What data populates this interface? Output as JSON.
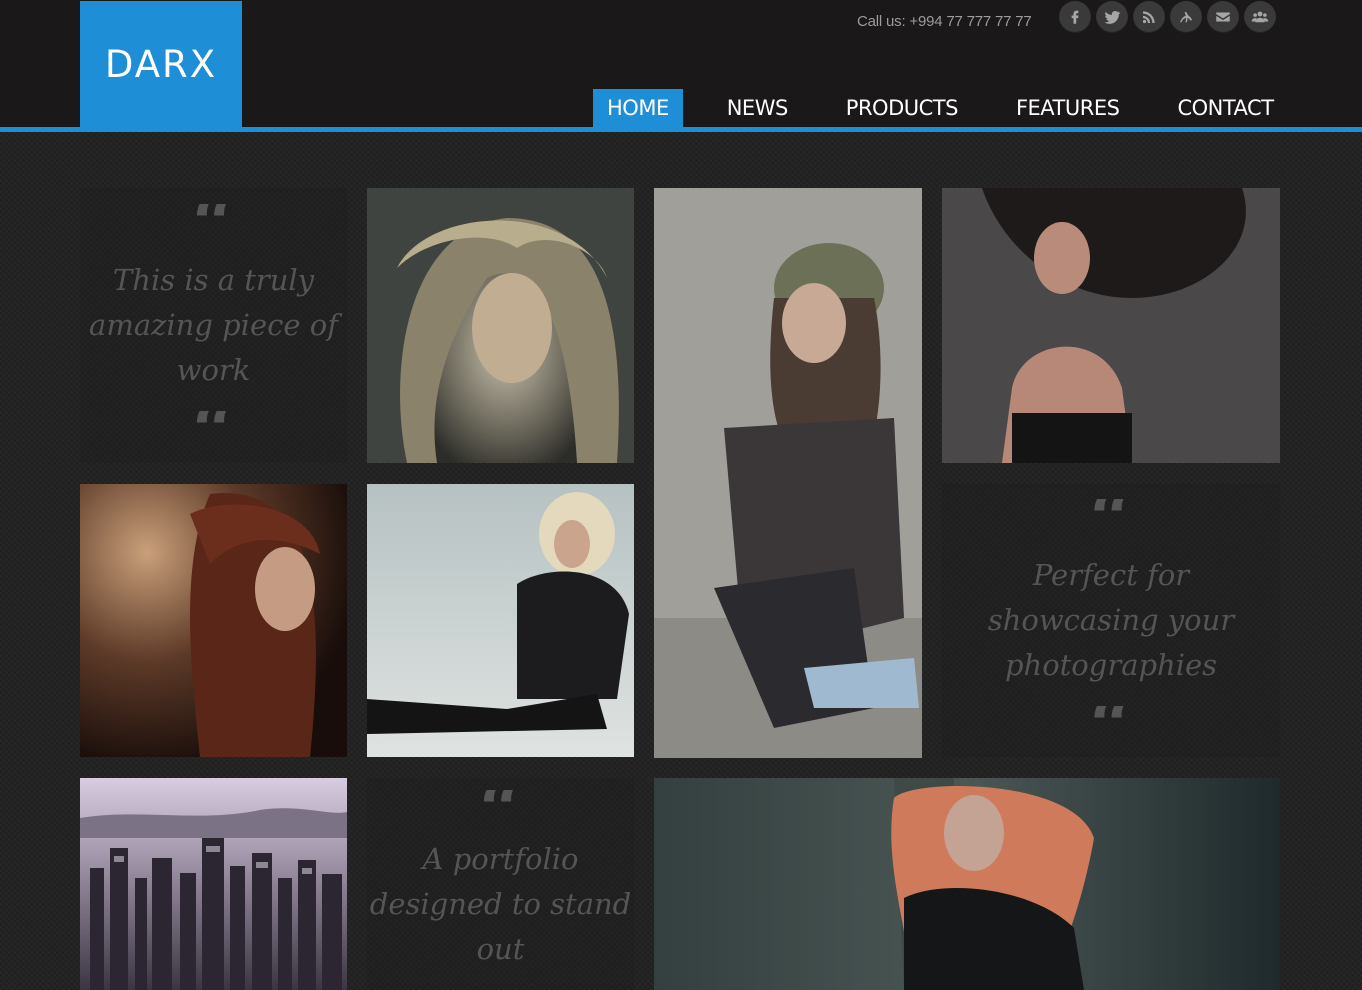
{
  "brand": {
    "name": "DARX"
  },
  "contact": {
    "call": "Call us: +994 77 777 77 77"
  },
  "social": [
    {
      "icon": "facebook-icon"
    },
    {
      "icon": "twitter-icon"
    },
    {
      "icon": "rss-icon"
    },
    {
      "icon": "dribbble-icon"
    },
    {
      "icon": "email-icon"
    },
    {
      "icon": "group-icon"
    }
  ],
  "nav": {
    "items": [
      {
        "label": "HOME",
        "active": true
      },
      {
        "label": "NEWS"
      },
      {
        "label": "PRODUCTS"
      },
      {
        "label": "FEATURES"
      },
      {
        "label": "CONTACT"
      }
    ]
  },
  "quotes": {
    "q1": {
      "open": "“",
      "close": "“",
      "text": "This is a truly amazing piece of work"
    },
    "q2": {
      "open": "“",
      "close": "“",
      "text": "Perfect for showcasing your photographies"
    },
    "q3": {
      "open": "“",
      "text": "A portfolio designed to stand out"
    }
  },
  "colors": {
    "accent": "#1e8fd6",
    "header_bg": "#1a1819",
    "body_bg": "#232323"
  }
}
